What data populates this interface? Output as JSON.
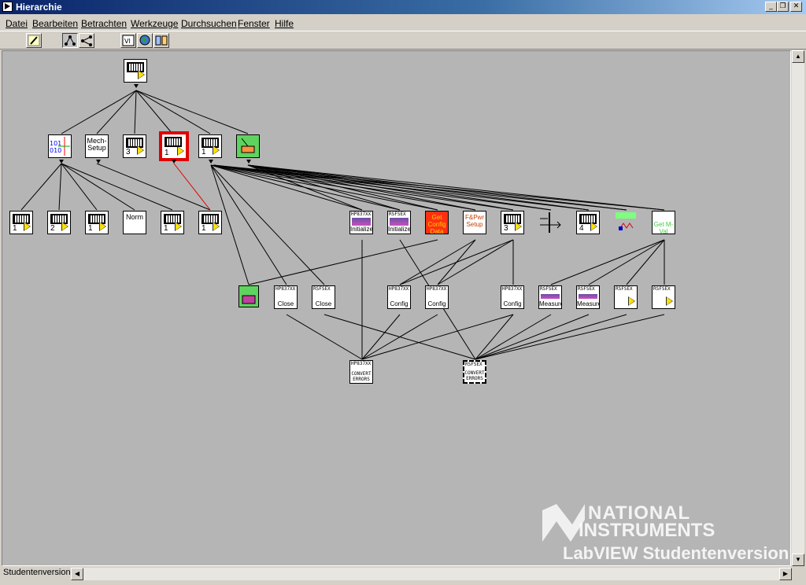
{
  "window": {
    "title": "Hierarchie"
  },
  "menu": [
    "Datei",
    "Bearbeiten",
    "Betrachten",
    "Werkzeuge",
    "Durchsuchen",
    "Fenster",
    "Hilfe"
  ],
  "toolbar": {
    "buttons": [
      "edit-pencil-icon",
      "vertical-layout-icon",
      "horizontal-layout-icon",
      "vi-icon",
      "globe-icon",
      "include-icon"
    ]
  },
  "nodes": {
    "root": "",
    "l1": {
      "a_num": "",
      "mech": "Mech-Setup",
      "b_num": "3",
      "selected_num": "1",
      "c_num": "1"
    },
    "l2": {
      "a": "1",
      "b": "2",
      "c": "1",
      "norm": "Norm",
      "d": "1",
      "e": "1",
      "hp_init_hdr": "HP837XX",
      "hp_init_lbl": "Initialize",
      "rs_init_hdr": "RSFSEX",
      "rs_init_lbl": "Initialize",
      "getconfig": "Get Config Data",
      "fpwr": "F&Pwr Setup",
      "f_num": "3",
      "g_num": "4"
    },
    "l3": {
      "hp_close_hdr": "HP837XX",
      "hp_close_lbl": "Close",
      "rs_close_hdr": "RSFSEX",
      "rs_close_lbl": "Close",
      "hp_cfg1_hdr": "HP837XX",
      "hp_cfg1_lbl": "Config",
      "hp_cfg2_hdr": "HP837XX",
      "hp_cfg2_lbl": "Config",
      "hp_cfg3_hdr": "HP837XX",
      "hp_cfg3_lbl": "Config",
      "rs_meas1_hdr": "RSFSEX",
      "rs_meas1_lbl": "Measure",
      "rs_meas2_hdr": "RSFSEX",
      "rs_meas2_lbl": "Measure",
      "rs_x1_hdr": "RSFSEX",
      "rs_x2_hdr": "RSFSEX"
    },
    "l4": {
      "hp_conv_hdr": "HP837XX",
      "hp_conv_lbl": "CONVERT ERRORS",
      "rs_conv_hdr": "RSFSEX",
      "rs_conv_lbl": "CONVERT ERRORS"
    }
  },
  "status": {
    "label": "Studentenversion"
  },
  "watermark": {
    "line1": "NATIONAL",
    "line2": "INSTRUMENTS",
    "line3": "LabVIEW Studentenversion"
  },
  "colors": {
    "selected": "#e00000",
    "link": "#000000",
    "selected_link": "#e00000",
    "canvas": "#b5b5b5"
  }
}
